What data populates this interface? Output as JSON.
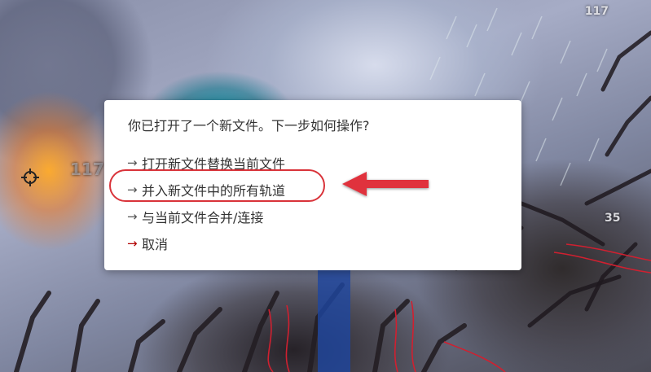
{
  "background": {
    "hud_numbers": [
      "117",
      "117",
      "35"
    ]
  },
  "dialog": {
    "question": "你已打开了一个新文件。下一步如何操作?",
    "options": [
      {
        "arrow": "→",
        "label": "打开新文件替换当前文件",
        "arrow_color": "#555555"
      },
      {
        "arrow": "→",
        "label": "并入新文件中的所有轨道",
        "arrow_color": "#555555"
      },
      {
        "arrow": "→",
        "label": "与当前文件合并/连接",
        "arrow_color": "#555555"
      },
      {
        "arrow": "→",
        "label": "取消",
        "arrow_color": "#b00000"
      }
    ]
  },
  "annotation": {
    "highlighted_option_index": 1,
    "color": "#d9333a",
    "pointer_icon": "left-arrow-icon"
  }
}
